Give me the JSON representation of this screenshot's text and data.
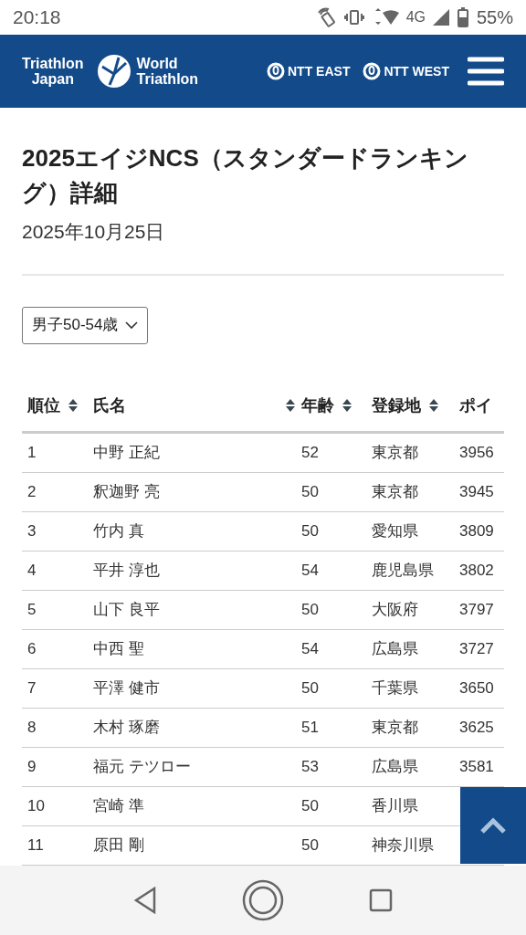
{
  "status_bar": {
    "time": "20:18",
    "network": "4G",
    "battery": "55%"
  },
  "header": {
    "brand_left": [
      "Triathlon",
      "Japan"
    ],
    "brand_right": [
      "World",
      "Triathlon"
    ],
    "sponsors": [
      "NTT EAST",
      "NTT WEST"
    ]
  },
  "page": {
    "title": "2025エイジNCS（スタンダードランキング）詳細",
    "date": "2025年10月25日"
  },
  "category_select": {
    "value": "男子50-54歳"
  },
  "table": {
    "columns": [
      {
        "label": "順位",
        "sortable": true
      },
      {
        "label": "氏名",
        "sortable": true
      },
      {
        "label": "年齢",
        "sortable": true
      },
      {
        "label": "登録地",
        "sortable": true
      },
      {
        "label": "ポイ",
        "sortable": false
      }
    ],
    "rows": [
      {
        "rank": "1",
        "name": "中野 正紀",
        "age": "52",
        "region": "東京都",
        "points": "3956"
      },
      {
        "rank": "2",
        "name": "釈迦野 亮",
        "age": "50",
        "region": "東京都",
        "points": "3945"
      },
      {
        "rank": "3",
        "name": "竹内 真",
        "age": "50",
        "region": "愛知県",
        "points": "3809"
      },
      {
        "rank": "4",
        "name": "平井 淳也",
        "age": "54",
        "region": "鹿児島県",
        "points": "3802"
      },
      {
        "rank": "5",
        "name": "山下 良平",
        "age": "50",
        "region": "大阪府",
        "points": "3797"
      },
      {
        "rank": "6",
        "name": "中西 聖",
        "age": "54",
        "region": "広島県",
        "points": "3727"
      },
      {
        "rank": "7",
        "name": "平澤 健市",
        "age": "50",
        "region": "千葉県",
        "points": "3650"
      },
      {
        "rank": "8",
        "name": "木村 琢磨",
        "age": "51",
        "region": "東京都",
        "points": "3625"
      },
      {
        "rank": "9",
        "name": "福元 テツロー",
        "age": "53",
        "region": "広島県",
        "points": "3581"
      },
      {
        "rank": "10",
        "name": "宮崎 準",
        "age": "50",
        "region": "香川県"
      },
      {
        "rank": "11",
        "name": "原田 剛",
        "age": "50",
        "region": "神奈川県"
      }
    ]
  }
}
